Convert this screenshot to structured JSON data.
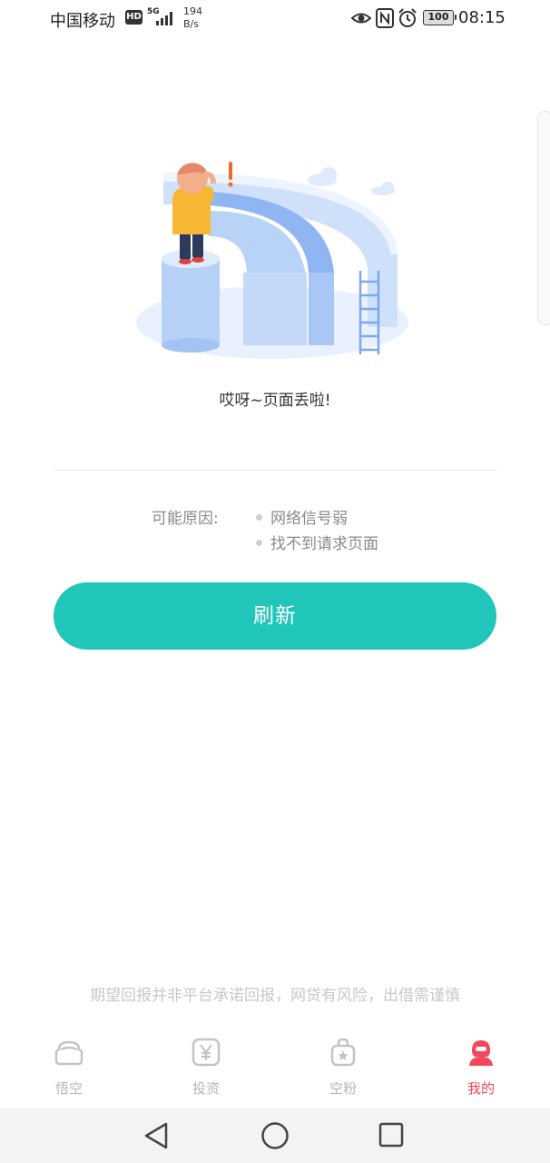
{
  "status_bar": {
    "carrier": "中国移动",
    "hd": "HD",
    "network": "5G",
    "speed_value": "194",
    "speed_unit": "B/s",
    "battery": "100",
    "time": "08:15"
  },
  "error": {
    "message": "哎呀~页面丢啦!",
    "reasons_label": "可能原因:",
    "reasons": [
      "网络信号弱",
      "找不到请求页面"
    ]
  },
  "refresh_label": "刷新",
  "disclaimer": "期望回报并非平台承诺回报，网贷有风险，出借需谨慎",
  "tabs": [
    {
      "label": "悟空",
      "icon": "wukong-icon",
      "active": false
    },
    {
      "label": "投资",
      "icon": "invest-yen-icon",
      "active": false
    },
    {
      "label": "空粉",
      "icon": "fans-bag-icon",
      "active": false
    },
    {
      "label": "我的",
      "icon": "profile-icon",
      "active": true
    }
  ],
  "colors": {
    "accent": "#1fc6b9",
    "active_tab": "#f1485b",
    "inactive_tab": "#b5b5b5",
    "muted_text": "#8a8a8a"
  }
}
